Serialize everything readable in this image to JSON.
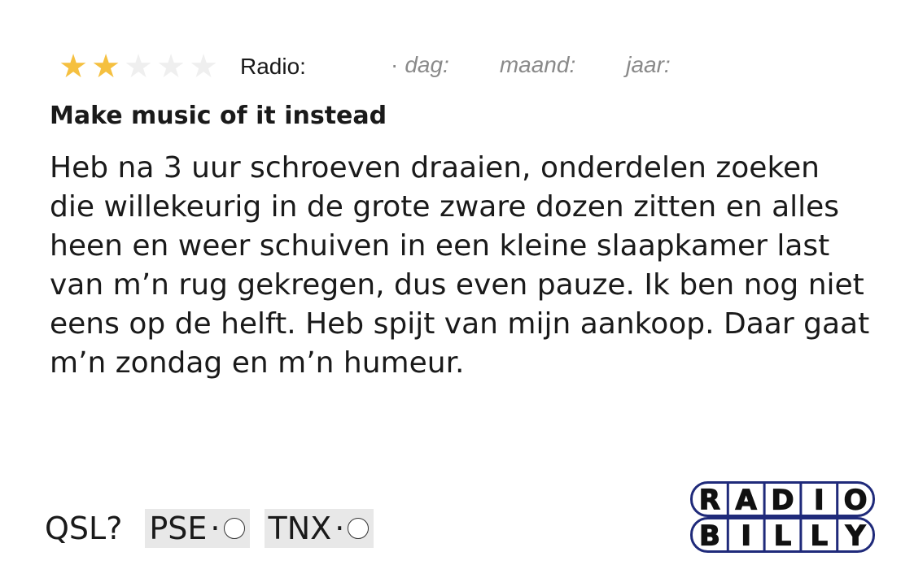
{
  "rating": {
    "value": 2,
    "max": 5,
    "filled_color": "#f5c040",
    "empty_color": "#efefef"
  },
  "header": {
    "radio_label": "Radio:",
    "dag_label": "dag:",
    "maand_label": "maand:",
    "jaar_label": "jaar:",
    "separator": "·"
  },
  "review": {
    "title": "Make music of it instead",
    "body": "Heb na 3 uur schroeven draaien, onderdelen zoeken die willekeurig in de grote zware dozen zitten en alles heen en weer schuiven in een kleine slaapkamer last van m’n rug gekregen, dus even pauze. Ik ben nog niet eens op de helft. Heb spijt van mijn aankoop. Daar gaat m’n zondag en m’n humeur."
  },
  "qsl": {
    "label": "QSL?",
    "options": [
      {
        "label": "PSE",
        "separator": "·"
      },
      {
        "label": "TNX",
        "separator": "·"
      }
    ]
  },
  "logo": {
    "line1": [
      "R",
      "A",
      "D",
      "I",
      "O"
    ],
    "line2": [
      "B",
      "I",
      "L",
      "L",
      "Y"
    ],
    "accent_color": "#1f2a7a"
  }
}
